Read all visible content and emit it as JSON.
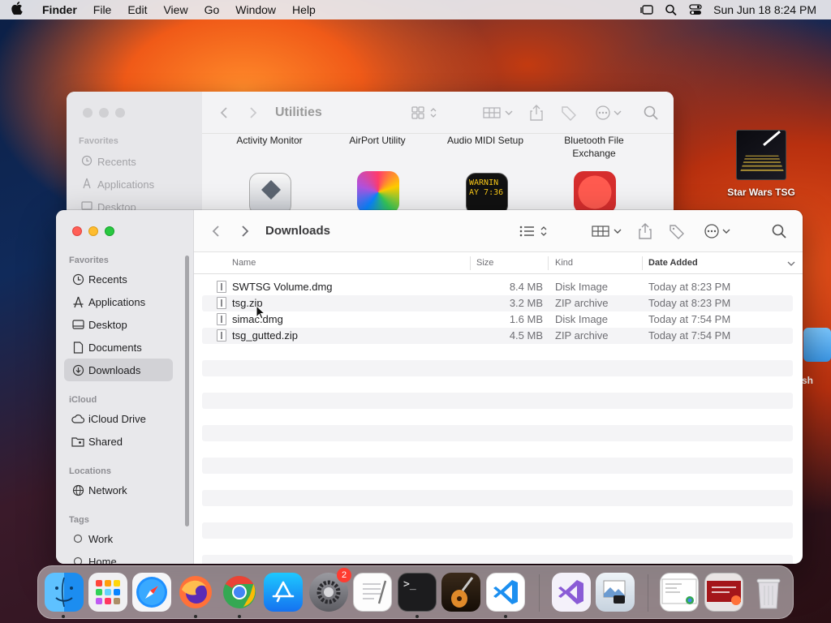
{
  "menubar": {
    "app_name": "Finder",
    "items": [
      "File",
      "Edit",
      "View",
      "Go",
      "Window",
      "Help"
    ],
    "clock": "Sun Jun 18  8:24 PM"
  },
  "desktop": {
    "item_label": "Star Wars TSG",
    "edge_label": "sh"
  },
  "back_window": {
    "title": "Utilities",
    "sidebar_section": "Favorites",
    "sidebar_items": [
      "Recents",
      "Applications",
      "Desktop"
    ],
    "apps": [
      {
        "name": "Activity Monitor"
      },
      {
        "name": "AirPort Utility"
      },
      {
        "name": "Audio MIDI Setup"
      },
      {
        "name": "Bluetooth File Exchange"
      }
    ],
    "console_icon_text": "WARNIN\nAY 7:36"
  },
  "window": {
    "title": "Downloads",
    "sidebar": {
      "favorites_label": "Favorites",
      "favorites": [
        "Recents",
        "Applications",
        "Desktop",
        "Documents",
        "Downloads"
      ],
      "icloud_label": "iCloud",
      "icloud": [
        "iCloud Drive",
        "Shared"
      ],
      "locations_label": "Locations",
      "locations": [
        "Network"
      ],
      "tags_label": "Tags",
      "tags": [
        "Work",
        "Home"
      ]
    },
    "columns": {
      "name": "Name",
      "size": "Size",
      "kind": "Kind",
      "date_added": "Date Added"
    },
    "files": [
      {
        "name": "SWTSG Volume.dmg",
        "size": "8.4 MB",
        "kind": "Disk Image",
        "date": "Today at 8:23 PM"
      },
      {
        "name": "tsg.zip",
        "size": "3.2 MB",
        "kind": "ZIP archive",
        "date": "Today at 8:23 PM"
      },
      {
        "name": "simac.dmg",
        "size": "1.6 MB",
        "kind": "Disk Image",
        "date": "Today at 7:54 PM"
      },
      {
        "name": "tsg_gutted.zip",
        "size": "4.5 MB",
        "kind": "ZIP archive",
        "date": "Today at 7:54 PM"
      }
    ]
  },
  "dock": {
    "settings_badge": "2",
    "terminal_prompt": ">_"
  },
  "colors": {
    "accent": "#0a84ff",
    "close": "#ff5f57",
    "minimize": "#febc2e",
    "zoom": "#28c840",
    "badge": "#ff3b30"
  }
}
